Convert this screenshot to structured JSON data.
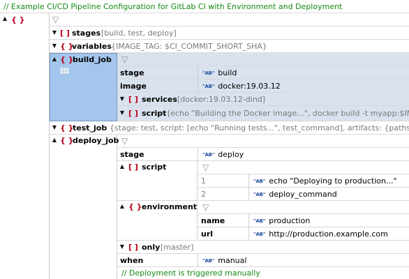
{
  "header_comment": "//   Example CI/CD Pipeline Configuration for GitLab CI with Environment and Deployment",
  "root_symbol": "{ }",
  "obj_symbol": "{ }",
  "arr_symbol": "[ ]",
  "string_badge": "\"AB\"",
  "stages": {
    "key": "stages",
    "summary": "[build, test, deploy]"
  },
  "variables": {
    "key": "variables",
    "summary": "{IMAGE_TAG: $CI_COMMIT_SHORT_SHA}"
  },
  "build_job": {
    "key": "build_job",
    "stage_key": "stage",
    "stage_value": "build",
    "image_key": "image",
    "image_value": "docker:19.03.12",
    "services_key": "services",
    "services_summary": "[docker:19.03.12-dind]",
    "script_key": "script",
    "script_summary": "[echo \"Building the Docker image...\", docker build -t myapp:$IM"
  },
  "test_job": {
    "key": "test_job",
    "summary": "{stage: test, script: [echo \"Running tests...\", test_command], artifacts: {paths: ..., e"
  },
  "deploy_job": {
    "key": "deploy_job",
    "stage_key": "stage",
    "stage_value": "deploy",
    "script_key": "script",
    "script_items": [
      {
        "index": "1",
        "value": "echo \"Deploying to production...\""
      },
      {
        "index": "2",
        "value": "deploy_command"
      }
    ],
    "environment_key": "environment",
    "env_name_key": "name",
    "env_name_value": "production",
    "env_url_key": "url",
    "env_url_value": "http://production.example.com",
    "only_key": "only",
    "only_summary": "[master]",
    "when_key": "when",
    "when_value": "manual",
    "comment": "//   Deployment is triggered manually"
  }
}
